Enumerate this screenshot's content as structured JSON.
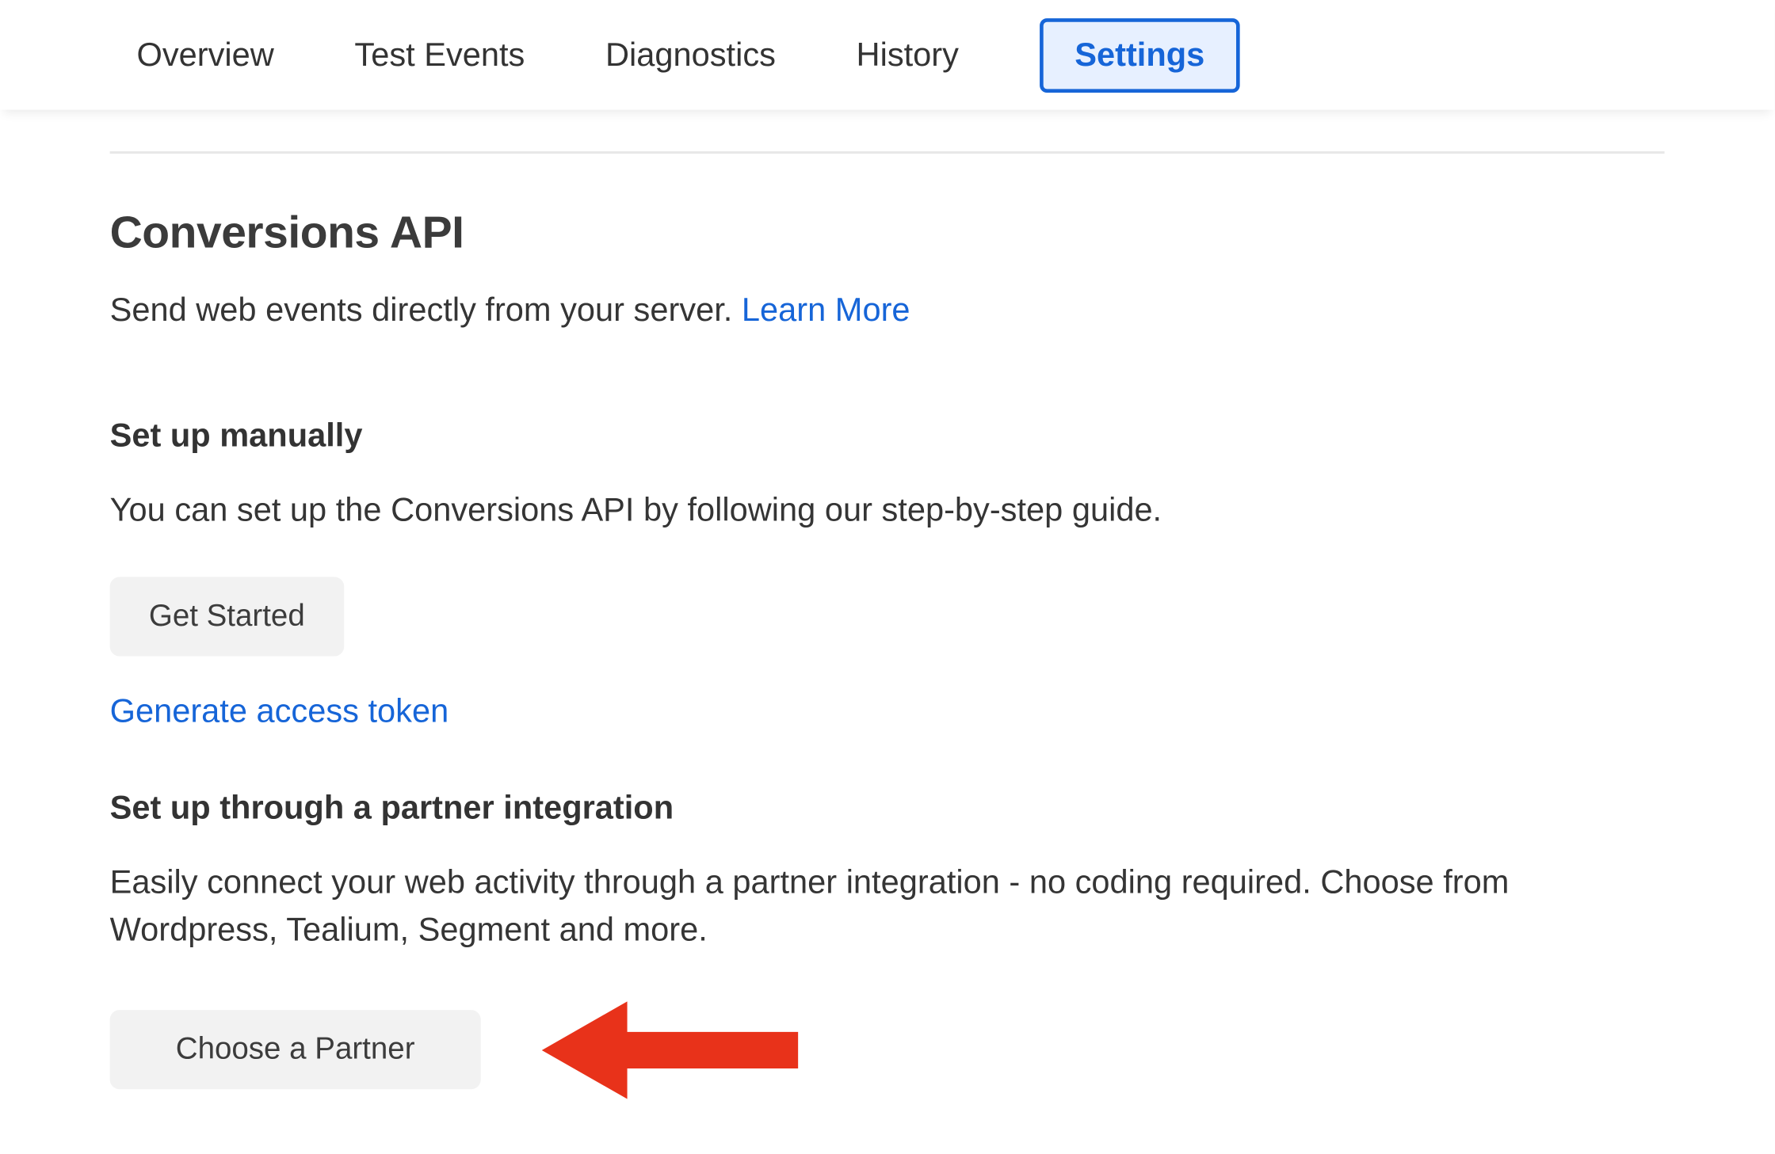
{
  "tabs": [
    {
      "label": "Overview",
      "active": false
    },
    {
      "label": "Test Events",
      "active": false
    },
    {
      "label": "Diagnostics",
      "active": false
    },
    {
      "label": "History",
      "active": false
    },
    {
      "label": "Settings",
      "active": true
    }
  ],
  "main": {
    "title": "Conversions API",
    "lead_text": "Send web events directly from your server. ",
    "learn_more": "Learn More",
    "manual": {
      "heading": "Set up manually",
      "body": "You can set up the Conversions API by following our step-by-step guide.",
      "get_started": "Get Started",
      "generate_token": "Generate access token"
    },
    "partner": {
      "heading": "Set up through a partner integration",
      "body": "Easily connect your web activity through a partner integration - no coding required. Choose from Wordpress, Tealium, Segment and more.",
      "choose_partner": "Choose a Partner"
    }
  },
  "annotation": {
    "arrow_color": "#e8321a"
  }
}
